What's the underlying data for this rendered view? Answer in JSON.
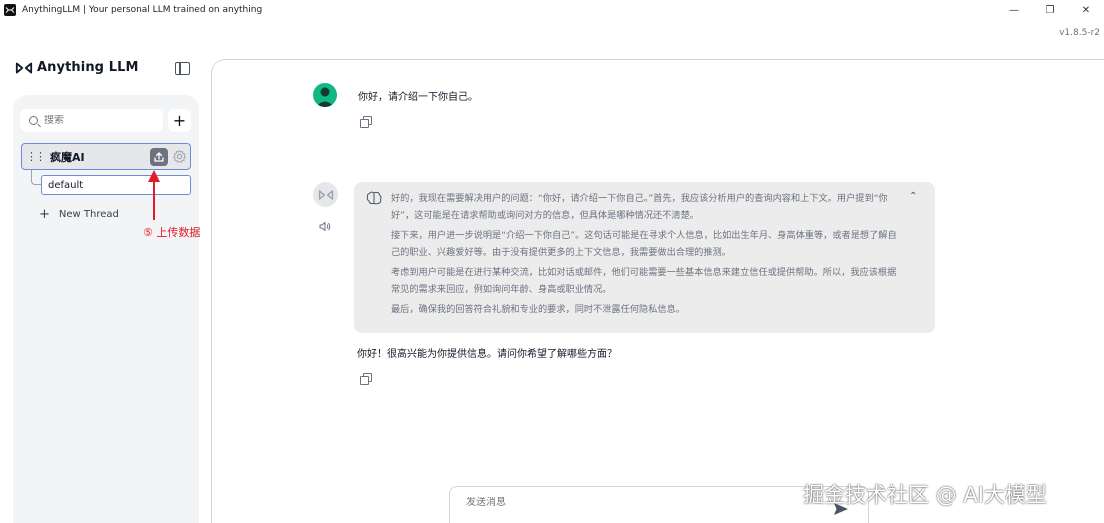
{
  "window": {
    "title": "AnythingLLM | Your personal LLM trained on anything",
    "minimize": "—",
    "maximize": "❐",
    "close": "✕"
  },
  "version": "v1.8.5-r2",
  "brand": {
    "name": "Anything LLM"
  },
  "sidebar": {
    "search_placeholder": "搜索",
    "add_label": "+",
    "workspace": {
      "name": "疯魔AI"
    },
    "threads": [
      {
        "name": "default"
      }
    ],
    "new_thread_label": "New Thread"
  },
  "annotation": {
    "text": "⑤ 上传数据",
    "color": "#e11d2a"
  },
  "chat": {
    "user_message": "你好，请介绍一下你自己。",
    "thought_paragraphs": [
      "好的，我现在需要解决用户的问题：“你好，请介绍一下你自己。”首先，我应该分析用户的查询内容和上下文。用户提到“你好”，这可能是在请求帮助或询问对方的信息，但具体是哪种情况还不清楚。",
      "接下来，用户进一步说明是“介绍一下你自己”。这句话可能是在寻求个人信息，比如出生年月、身高体重等，或者是想了解自己的职业、兴趣爱好等。由于没有提供更多的上下文信息，我需要做出合理的推测。",
      "考虑到用户可能是在进行某种交流，比如对话或邮件，他们可能需要一些基本信息来建立信任或提供帮助。所以，我应该根据常见的需求来回应，例如询问年龄、身高或职业情况。",
      "最后，确保我的回答符合礼貌和专业的要求，同时不泄露任何隐私信息。"
    ],
    "assistant_answer": "你好！很高兴能为你提供信息。请问你希望了解哪些方面？",
    "composer_placeholder": "发送消息"
  },
  "watermark": "掘金技术社区 @ AI大模型",
  "colors": {
    "accent": "#6b8dd6",
    "user_avatar": "#10b981",
    "thought_bg": "#ececec"
  }
}
